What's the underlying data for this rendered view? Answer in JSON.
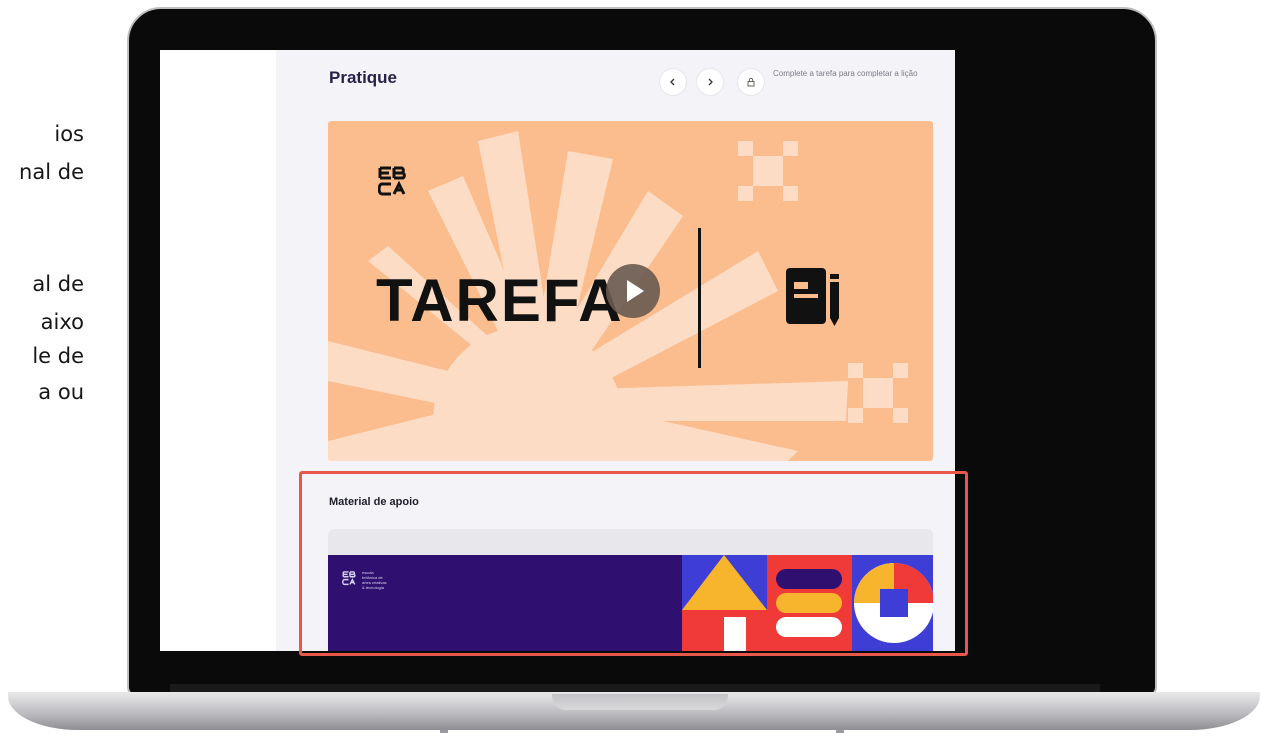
{
  "left_text": {
    "lines": [
      "ios",
      "nal de",
      "al de",
      "aixo",
      "le de",
      "a ou"
    ]
  },
  "app": {
    "page_title": "Pratique",
    "nav": {
      "prev_icon": "chevron-left-icon",
      "next_icon": "chevron-right-icon",
      "lock_icon": "lock-icon"
    },
    "task_message": "Complete a tarefa para completar a lição"
  },
  "video": {
    "title": "TAREFA",
    "play_icon": "play-icon",
    "doc_icon": "document-pen-icon",
    "background": "#fbbd8d"
  },
  "support": {
    "title": "Material de apoio",
    "banner_text": "escola\nbritânica de\nartes criativas\n& tecnologia"
  },
  "colors": {
    "accent_red": "#e8584a",
    "banner_purple": "#2f1070",
    "title_dark": "#28214a"
  }
}
